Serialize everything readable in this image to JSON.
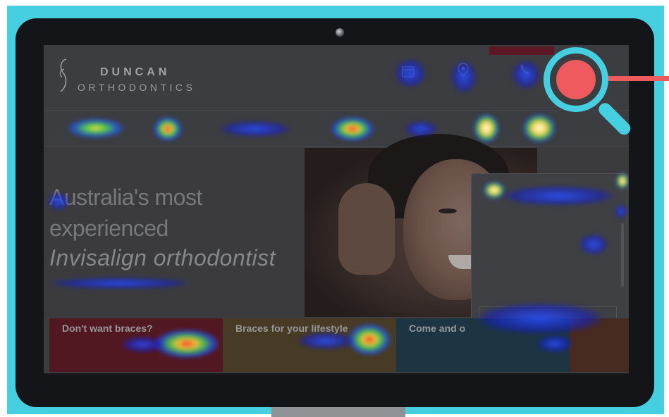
{
  "brand": {
    "name": "DUNCAN",
    "subtitle": "ORTHODONTICS",
    "logo_icon": "script-d-icon"
  },
  "header": {
    "top_strip_label": "",
    "icons": [
      {
        "icon": "calendar-icon",
        "label": ""
      },
      {
        "icon": "map-pin-icon",
        "label": ""
      },
      {
        "icon": "phone-icon",
        "label": ""
      }
    ]
  },
  "nav": {
    "items": [
      "",
      "",
      "",
      "",
      "",
      "",
      ""
    ]
  },
  "hero": {
    "headline_1": "Australia's most",
    "headline_2": "experienced",
    "headline_3": "Invisalign orthodontist",
    "sub_link": ""
  },
  "chat": {
    "header_text": "",
    "input_text": ""
  },
  "cards": [
    {
      "title": "Don't want braces?",
      "line1": "",
      "line2": "",
      "line3": "",
      "color": "#6a1a24"
    },
    {
      "title": "Braces for your lifestyle",
      "line1": "",
      "line2": "",
      "color": "#5b4a2a"
    },
    {
      "title": "Come and o",
      "line1": "",
      "line2": "",
      "color": "#214052"
    }
  ],
  "colors": {
    "frame": "#45cfe0",
    "accent_red": "#ef5a5f",
    "monitor": "#141518"
  },
  "overlay": {
    "magnifier_icon": "magnifier-icon",
    "type": "eye-tracking heatmap"
  }
}
